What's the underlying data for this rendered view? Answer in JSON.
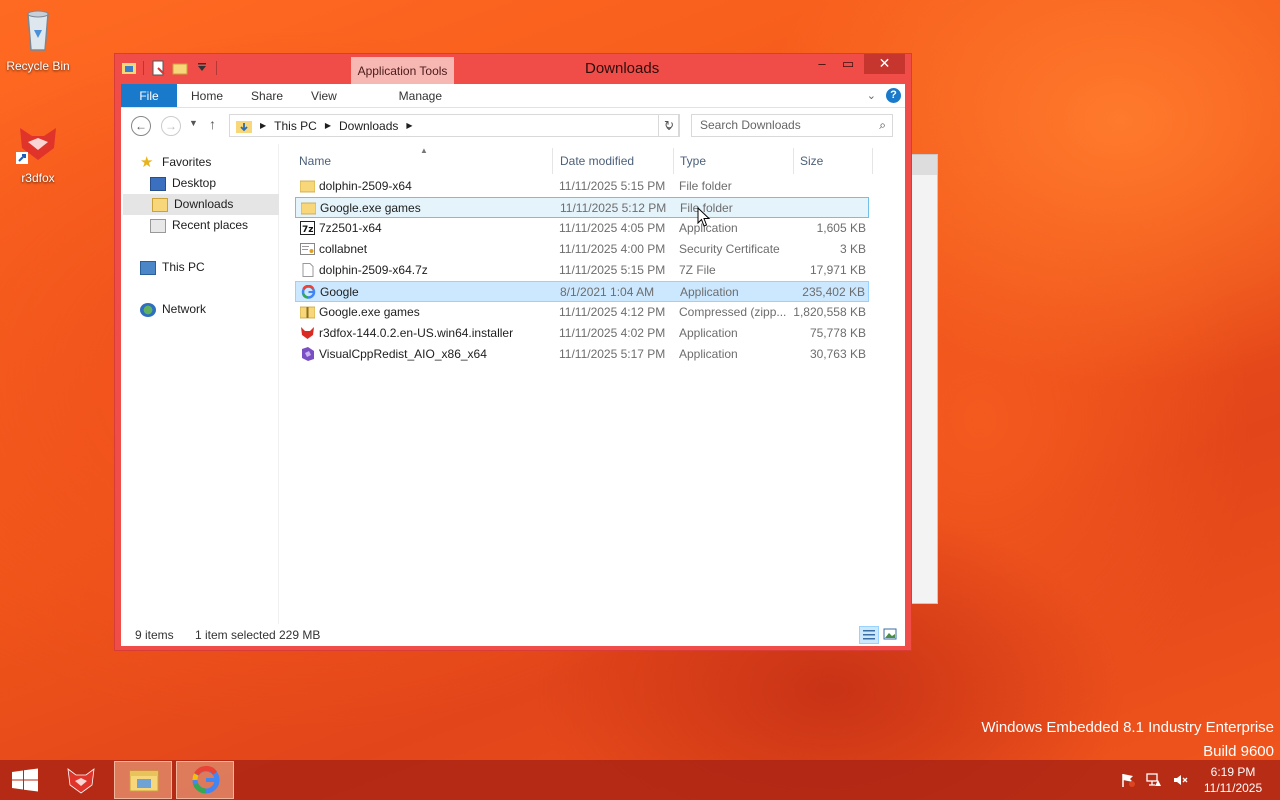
{
  "desktop": {
    "icons": [
      {
        "label": "Recycle Bin",
        "icon": "recycle-bin-icon"
      },
      {
        "label": "r3dfox",
        "icon": "r3dfox-app-icon"
      }
    ],
    "watermark": {
      "line1": "Windows Embedded 8.1 Industry Enterprise",
      "line2": "Build 9600"
    }
  },
  "window": {
    "title": "Downloads",
    "contextual_tab": "Application Tools",
    "ribbon_tabs": [
      "File",
      "Home",
      "Share",
      "View",
      "Manage"
    ],
    "address_path": [
      "This PC",
      "Downloads"
    ],
    "search_placeholder": "Search Downloads",
    "accent": "#f04d48"
  },
  "navpane": {
    "favorites": "Favorites",
    "desktop": "Desktop",
    "downloads": "Downloads",
    "recent": "Recent places",
    "this_pc": "This PC",
    "network": "Network"
  },
  "columns": {
    "name": "Name",
    "date": "Date modified",
    "type": "Type",
    "size": "Size"
  },
  "files": [
    {
      "name": "dolphin-2509-x64",
      "date": "11/11/2025 5:15 PM",
      "type": "File folder",
      "size": "",
      "icon": "folder-icon"
    },
    {
      "name": "Google.exe games",
      "date": "11/11/2025 5:12 PM",
      "type": "File folder",
      "size": "",
      "icon": "folder-icon"
    },
    {
      "name": "7z2501-x64",
      "date": "11/11/2025 4:05 PM",
      "type": "Application",
      "size": "1,605 KB",
      "icon": "7zip-icon"
    },
    {
      "name": "collabnet",
      "date": "11/11/2025 4:00 PM",
      "type": "Security Certificate",
      "size": "3 KB",
      "icon": "certificate-icon"
    },
    {
      "name": "dolphin-2509-x64.7z",
      "date": "11/11/2025 5:15 PM",
      "type": "7Z File",
      "size": "17,971 KB",
      "icon": "file-icon"
    },
    {
      "name": "Google",
      "date": "8/1/2021 1:04 AM",
      "type": "Application",
      "size": "235,402 KB",
      "icon": "google-icon"
    },
    {
      "name": "Google.exe games",
      "date": "11/11/2025 4:12 PM",
      "type": "Compressed (zipp...",
      "size": "1,820,558 KB",
      "icon": "zip-folder-icon"
    },
    {
      "name": "r3dfox-144.0.2.en-US.win64.installer",
      "date": "11/11/2025 4:02 PM",
      "type": "Application",
      "size": "75,778 KB",
      "icon": "r3dfox-icon"
    },
    {
      "name": "VisualCppRedist_AIO_x86_x64",
      "date": "11/11/2025 5:17 PM",
      "type": "Application",
      "size": "30,763 KB",
      "icon": "installer-icon"
    }
  ],
  "status": {
    "items": "9 items",
    "selected": "1 item selected",
    "size": "229 MB"
  },
  "taskbar": {
    "time": "6:19 PM",
    "date": "11/11/2025"
  }
}
